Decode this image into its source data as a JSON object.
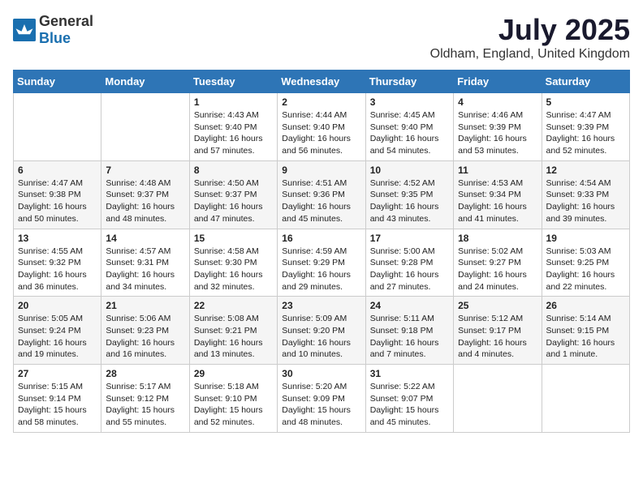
{
  "header": {
    "logo_general": "General",
    "logo_blue": "Blue",
    "title": "July 2025",
    "location": "Oldham, England, United Kingdom"
  },
  "days_of_week": [
    "Sunday",
    "Monday",
    "Tuesday",
    "Wednesday",
    "Thursday",
    "Friday",
    "Saturday"
  ],
  "weeks": [
    [
      {
        "day": "",
        "sunrise": "",
        "sunset": "",
        "daylight": ""
      },
      {
        "day": "",
        "sunrise": "",
        "sunset": "",
        "daylight": ""
      },
      {
        "day": "1",
        "sunrise": "Sunrise: 4:43 AM",
        "sunset": "Sunset: 9:40 PM",
        "daylight": "Daylight: 16 hours and 57 minutes."
      },
      {
        "day": "2",
        "sunrise": "Sunrise: 4:44 AM",
        "sunset": "Sunset: 9:40 PM",
        "daylight": "Daylight: 16 hours and 56 minutes."
      },
      {
        "day": "3",
        "sunrise": "Sunrise: 4:45 AM",
        "sunset": "Sunset: 9:40 PM",
        "daylight": "Daylight: 16 hours and 54 minutes."
      },
      {
        "day": "4",
        "sunrise": "Sunrise: 4:46 AM",
        "sunset": "Sunset: 9:39 PM",
        "daylight": "Daylight: 16 hours and 53 minutes."
      },
      {
        "day": "5",
        "sunrise": "Sunrise: 4:47 AM",
        "sunset": "Sunset: 9:39 PM",
        "daylight": "Daylight: 16 hours and 52 minutes."
      }
    ],
    [
      {
        "day": "6",
        "sunrise": "Sunrise: 4:47 AM",
        "sunset": "Sunset: 9:38 PM",
        "daylight": "Daylight: 16 hours and 50 minutes."
      },
      {
        "day": "7",
        "sunrise": "Sunrise: 4:48 AM",
        "sunset": "Sunset: 9:37 PM",
        "daylight": "Daylight: 16 hours and 48 minutes."
      },
      {
        "day": "8",
        "sunrise": "Sunrise: 4:50 AM",
        "sunset": "Sunset: 9:37 PM",
        "daylight": "Daylight: 16 hours and 47 minutes."
      },
      {
        "day": "9",
        "sunrise": "Sunrise: 4:51 AM",
        "sunset": "Sunset: 9:36 PM",
        "daylight": "Daylight: 16 hours and 45 minutes."
      },
      {
        "day": "10",
        "sunrise": "Sunrise: 4:52 AM",
        "sunset": "Sunset: 9:35 PM",
        "daylight": "Daylight: 16 hours and 43 minutes."
      },
      {
        "day": "11",
        "sunrise": "Sunrise: 4:53 AM",
        "sunset": "Sunset: 9:34 PM",
        "daylight": "Daylight: 16 hours and 41 minutes."
      },
      {
        "day": "12",
        "sunrise": "Sunrise: 4:54 AM",
        "sunset": "Sunset: 9:33 PM",
        "daylight": "Daylight: 16 hours and 39 minutes."
      }
    ],
    [
      {
        "day": "13",
        "sunrise": "Sunrise: 4:55 AM",
        "sunset": "Sunset: 9:32 PM",
        "daylight": "Daylight: 16 hours and 36 minutes."
      },
      {
        "day": "14",
        "sunrise": "Sunrise: 4:57 AM",
        "sunset": "Sunset: 9:31 PM",
        "daylight": "Daylight: 16 hours and 34 minutes."
      },
      {
        "day": "15",
        "sunrise": "Sunrise: 4:58 AM",
        "sunset": "Sunset: 9:30 PM",
        "daylight": "Daylight: 16 hours and 32 minutes."
      },
      {
        "day": "16",
        "sunrise": "Sunrise: 4:59 AM",
        "sunset": "Sunset: 9:29 PM",
        "daylight": "Daylight: 16 hours and 29 minutes."
      },
      {
        "day": "17",
        "sunrise": "Sunrise: 5:00 AM",
        "sunset": "Sunset: 9:28 PM",
        "daylight": "Daylight: 16 hours and 27 minutes."
      },
      {
        "day": "18",
        "sunrise": "Sunrise: 5:02 AM",
        "sunset": "Sunset: 9:27 PM",
        "daylight": "Daylight: 16 hours and 24 minutes."
      },
      {
        "day": "19",
        "sunrise": "Sunrise: 5:03 AM",
        "sunset": "Sunset: 9:25 PM",
        "daylight": "Daylight: 16 hours and 22 minutes."
      }
    ],
    [
      {
        "day": "20",
        "sunrise": "Sunrise: 5:05 AM",
        "sunset": "Sunset: 9:24 PM",
        "daylight": "Daylight: 16 hours and 19 minutes."
      },
      {
        "day": "21",
        "sunrise": "Sunrise: 5:06 AM",
        "sunset": "Sunset: 9:23 PM",
        "daylight": "Daylight: 16 hours and 16 minutes."
      },
      {
        "day": "22",
        "sunrise": "Sunrise: 5:08 AM",
        "sunset": "Sunset: 9:21 PM",
        "daylight": "Daylight: 16 hours and 13 minutes."
      },
      {
        "day": "23",
        "sunrise": "Sunrise: 5:09 AM",
        "sunset": "Sunset: 9:20 PM",
        "daylight": "Daylight: 16 hours and 10 minutes."
      },
      {
        "day": "24",
        "sunrise": "Sunrise: 5:11 AM",
        "sunset": "Sunset: 9:18 PM",
        "daylight": "Daylight: 16 hours and 7 minutes."
      },
      {
        "day": "25",
        "sunrise": "Sunrise: 5:12 AM",
        "sunset": "Sunset: 9:17 PM",
        "daylight": "Daylight: 16 hours and 4 minutes."
      },
      {
        "day": "26",
        "sunrise": "Sunrise: 5:14 AM",
        "sunset": "Sunset: 9:15 PM",
        "daylight": "Daylight: 16 hours and 1 minute."
      }
    ],
    [
      {
        "day": "27",
        "sunrise": "Sunrise: 5:15 AM",
        "sunset": "Sunset: 9:14 PM",
        "daylight": "Daylight: 15 hours and 58 minutes."
      },
      {
        "day": "28",
        "sunrise": "Sunrise: 5:17 AM",
        "sunset": "Sunset: 9:12 PM",
        "daylight": "Daylight: 15 hours and 55 minutes."
      },
      {
        "day": "29",
        "sunrise": "Sunrise: 5:18 AM",
        "sunset": "Sunset: 9:10 PM",
        "daylight": "Daylight: 15 hours and 52 minutes."
      },
      {
        "day": "30",
        "sunrise": "Sunrise: 5:20 AM",
        "sunset": "Sunset: 9:09 PM",
        "daylight": "Daylight: 15 hours and 48 minutes."
      },
      {
        "day": "31",
        "sunrise": "Sunrise: 5:22 AM",
        "sunset": "Sunset: 9:07 PM",
        "daylight": "Daylight: 15 hours and 45 minutes."
      },
      {
        "day": "",
        "sunrise": "",
        "sunset": "",
        "daylight": ""
      },
      {
        "day": "",
        "sunrise": "",
        "sunset": "",
        "daylight": ""
      }
    ]
  ]
}
